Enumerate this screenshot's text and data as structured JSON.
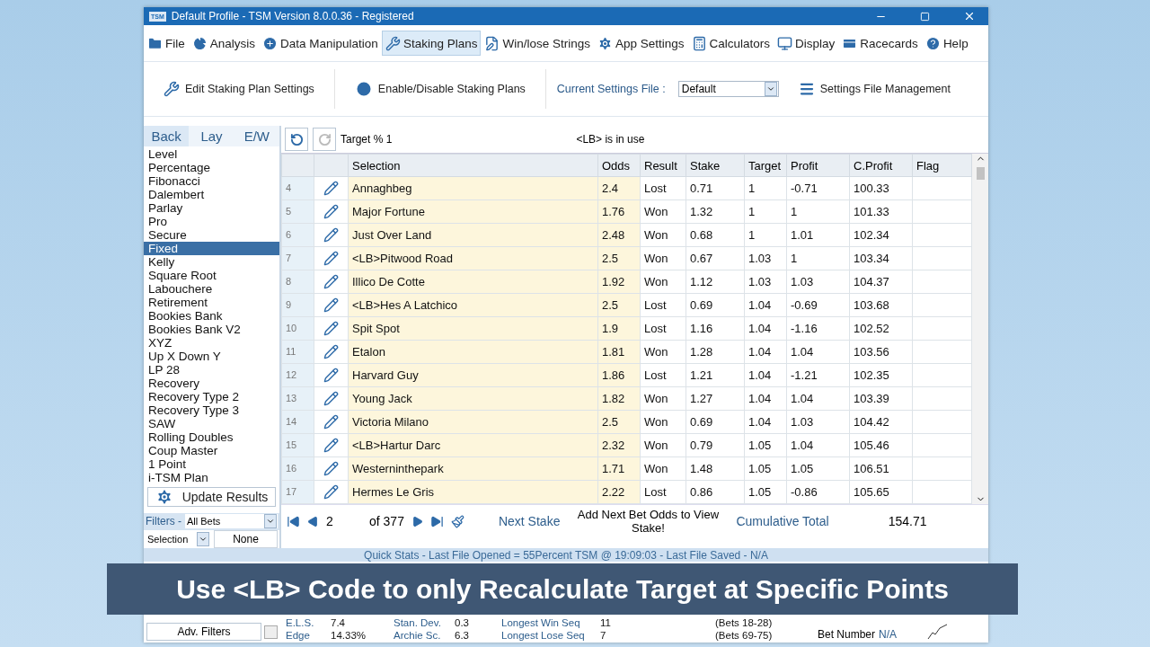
{
  "window": {
    "badge": "TSM",
    "title": "Default Profile  - TSM Version 8.0.0.36 - Registered"
  },
  "menu": [
    {
      "label": "File",
      "kind": "folder",
      "selected": false
    },
    {
      "label": "Analysis",
      "kind": "pie",
      "selected": false
    },
    {
      "label": "Data Manipulation",
      "kind": "plus",
      "selected": false
    },
    {
      "label": "Staking Plans",
      "kind": "wrench",
      "selected": true
    },
    {
      "label": "Win/lose Strings",
      "kind": "edit",
      "selected": false
    },
    {
      "label": "App Settings",
      "kind": "gear",
      "selected": false
    },
    {
      "label": "Calculators",
      "kind": "calculator",
      "selected": false
    },
    {
      "label": "Display",
      "kind": "monitor",
      "selected": false
    },
    {
      "label": "Racecards",
      "kind": "card",
      "selected": false
    },
    {
      "label": "Help",
      "kind": "help",
      "selected": false
    }
  ],
  "ribbon": {
    "edit_button": "Edit Staking Plan Settings",
    "enable_button": "Enable/Disable Staking Plans",
    "settings_label": "Current Settings File :",
    "settings_value": "Default",
    "management_button": "Settings File Management"
  },
  "staking_tabs": [
    {
      "label": "Back",
      "selected": true
    },
    {
      "label": "Lay",
      "selected": false
    },
    {
      "label": "E/W",
      "selected": false
    }
  ],
  "plans": [
    {
      "label": "Level",
      "selected": false
    },
    {
      "label": "Percentage",
      "selected": false
    },
    {
      "label": "Fibonacci",
      "selected": false
    },
    {
      "label": "Dalembert",
      "selected": false
    },
    {
      "label": "Parlay",
      "selected": false
    },
    {
      "label": "Pro",
      "selected": false
    },
    {
      "label": "Secure",
      "selected": false
    },
    {
      "label": "Fixed",
      "selected": true
    },
    {
      "label": "Kelly",
      "selected": false
    },
    {
      "label": "Square Root",
      "selected": false
    },
    {
      "label": "Labouchere",
      "selected": false
    },
    {
      "label": "Retirement",
      "selected": false
    },
    {
      "label": "Bookies Bank",
      "selected": false
    },
    {
      "label": "Bookies Bank V2",
      "selected": false
    },
    {
      "label": "XYZ",
      "selected": false
    },
    {
      "label": "Up X Down Y",
      "selected": false
    },
    {
      "label": "LP 28",
      "selected": false
    },
    {
      "label": "Recovery",
      "selected": false
    },
    {
      "label": "Recovery Type 2",
      "selected": false
    },
    {
      "label": "Recovery Type 3",
      "selected": false
    },
    {
      "label": "SAW",
      "selected": false
    },
    {
      "label": "Rolling Doubles",
      "selected": false
    },
    {
      "label": "Coup Master",
      "selected": false
    },
    {
      "label": "1 Point",
      "selected": false
    },
    {
      "label": "i-TSM Plan",
      "selected": false
    }
  ],
  "update_button": "Update Results",
  "filters": {
    "label": "Filters -",
    "value": "All Bets"
  },
  "selection_filter": {
    "label": "Selection",
    "value": "None"
  },
  "adv_filters": {
    "label": "Adv. Filters",
    "checked": false
  },
  "grid": {
    "target_label": "Target % 1",
    "note": "<LB> is in use",
    "columns": [
      "Selection",
      "Odds",
      "Result",
      "Stake",
      "Target",
      "Profit",
      "C.Profit",
      "Flag"
    ],
    "rows": [
      {
        "num": "4",
        "selection": "Annaghbeg",
        "odds": "2.4",
        "result": "Lost",
        "stake": "0.71",
        "target": "1",
        "profit": "-0.71",
        "cprofit": "100.33"
      },
      {
        "num": "5",
        "selection": "Major Fortune",
        "odds": "1.76",
        "result": "Won",
        "stake": "1.32",
        "target": "1",
        "profit": "1",
        "cprofit": "101.33"
      },
      {
        "num": "6",
        "selection": "Just Over Land",
        "odds": "2.48",
        "result": "Won",
        "stake": "0.68",
        "target": "1",
        "profit": "1.01",
        "cprofit": "102.34"
      },
      {
        "num": "7",
        "selection": "<LB>Pitwood Road",
        "odds": "2.5",
        "result": "Won",
        "stake": "0.67",
        "target": "1.03",
        "profit": "1",
        "cprofit": "103.34"
      },
      {
        "num": "8",
        "selection": "Illico De Cotte",
        "odds": "1.92",
        "result": "Won",
        "stake": "1.12",
        "target": "1.03",
        "profit": "1.03",
        "cprofit": "104.37"
      },
      {
        "num": "9",
        "selection": "<LB>Hes A Latchico",
        "odds": "2.5",
        "result": "Lost",
        "stake": "0.69",
        "target": "1.04",
        "profit": "-0.69",
        "cprofit": "103.68"
      },
      {
        "num": "10",
        "selection": "Spit Spot",
        "odds": "1.9",
        "result": "Lost",
        "stake": "1.16",
        "target": "1.04",
        "profit": "-1.16",
        "cprofit": "102.52"
      },
      {
        "num": "11",
        "selection": "Etalon",
        "odds": "1.81",
        "result": "Won",
        "stake": "1.28",
        "target": "1.04",
        "profit": "1.04",
        "cprofit": "103.56"
      },
      {
        "num": "12",
        "selection": "Harvard Guy",
        "odds": "1.86",
        "result": "Lost",
        "stake": "1.21",
        "target": "1.04",
        "profit": "-1.21",
        "cprofit": "102.35"
      },
      {
        "num": "13",
        "selection": "Young Jack",
        "odds": "1.82",
        "result": "Won",
        "stake": "1.27",
        "target": "1.04",
        "profit": "1.04",
        "cprofit": "103.39"
      },
      {
        "num": "14",
        "selection": "Victoria Milano",
        "odds": "2.5",
        "result": "Won",
        "stake": "0.69",
        "target": "1.04",
        "profit": "1.03",
        "cprofit": "104.42"
      },
      {
        "num": "15",
        "selection": "<LB>Hartur Darc",
        "odds": "2.32",
        "result": "Won",
        "stake": "0.79",
        "target": "1.05",
        "profit": "1.04",
        "cprofit": "105.46"
      },
      {
        "num": "16",
        "selection": "Westerninthepark",
        "odds": "1.71",
        "result": "Won",
        "stake": "1.48",
        "target": "1.05",
        "profit": "1.05",
        "cprofit": "106.51"
      },
      {
        "num": "17",
        "selection": "Hermes Le Gris",
        "odds": "2.22",
        "result": "Lost",
        "stake": "0.86",
        "target": "1.05",
        "profit": "-0.86",
        "cprofit": "105.65"
      }
    ]
  },
  "pager": {
    "current": "2",
    "total": "of 377",
    "next_stake_label": "Next Stake",
    "next_stake_message": "Add Next Bet Odds to View Stake!",
    "cumulative_label": "Cumulative Total",
    "cumulative_value": "154.71"
  },
  "quick_stats": "Quick Stats - Last File Opened = 55Percent TSM @ 19:09:03 - Last File Saved - N/A",
  "stats": [
    {
      "label": "E.L.S.",
      "value": "7.4",
      "label_2": "Stan. Dev.",
      "value_2": "0.3",
      "label_3": "Longest Win Seq",
      "value_3": "11",
      "detail": "(Bets 18-28)"
    },
    {
      "label": "Edge",
      "value": "14.33%",
      "label_2": "Archie Sc.",
      "value_2": "6.3",
      "label_3": "Longest Lose Seq",
      "value_3": "7",
      "detail": "(Bets 69-75)"
    }
  ],
  "bet_number": {
    "label": "Bet Number",
    "value": "N/A"
  },
  "caption": "Use <LB> Code to only Recalculate Target at Specific Points"
}
